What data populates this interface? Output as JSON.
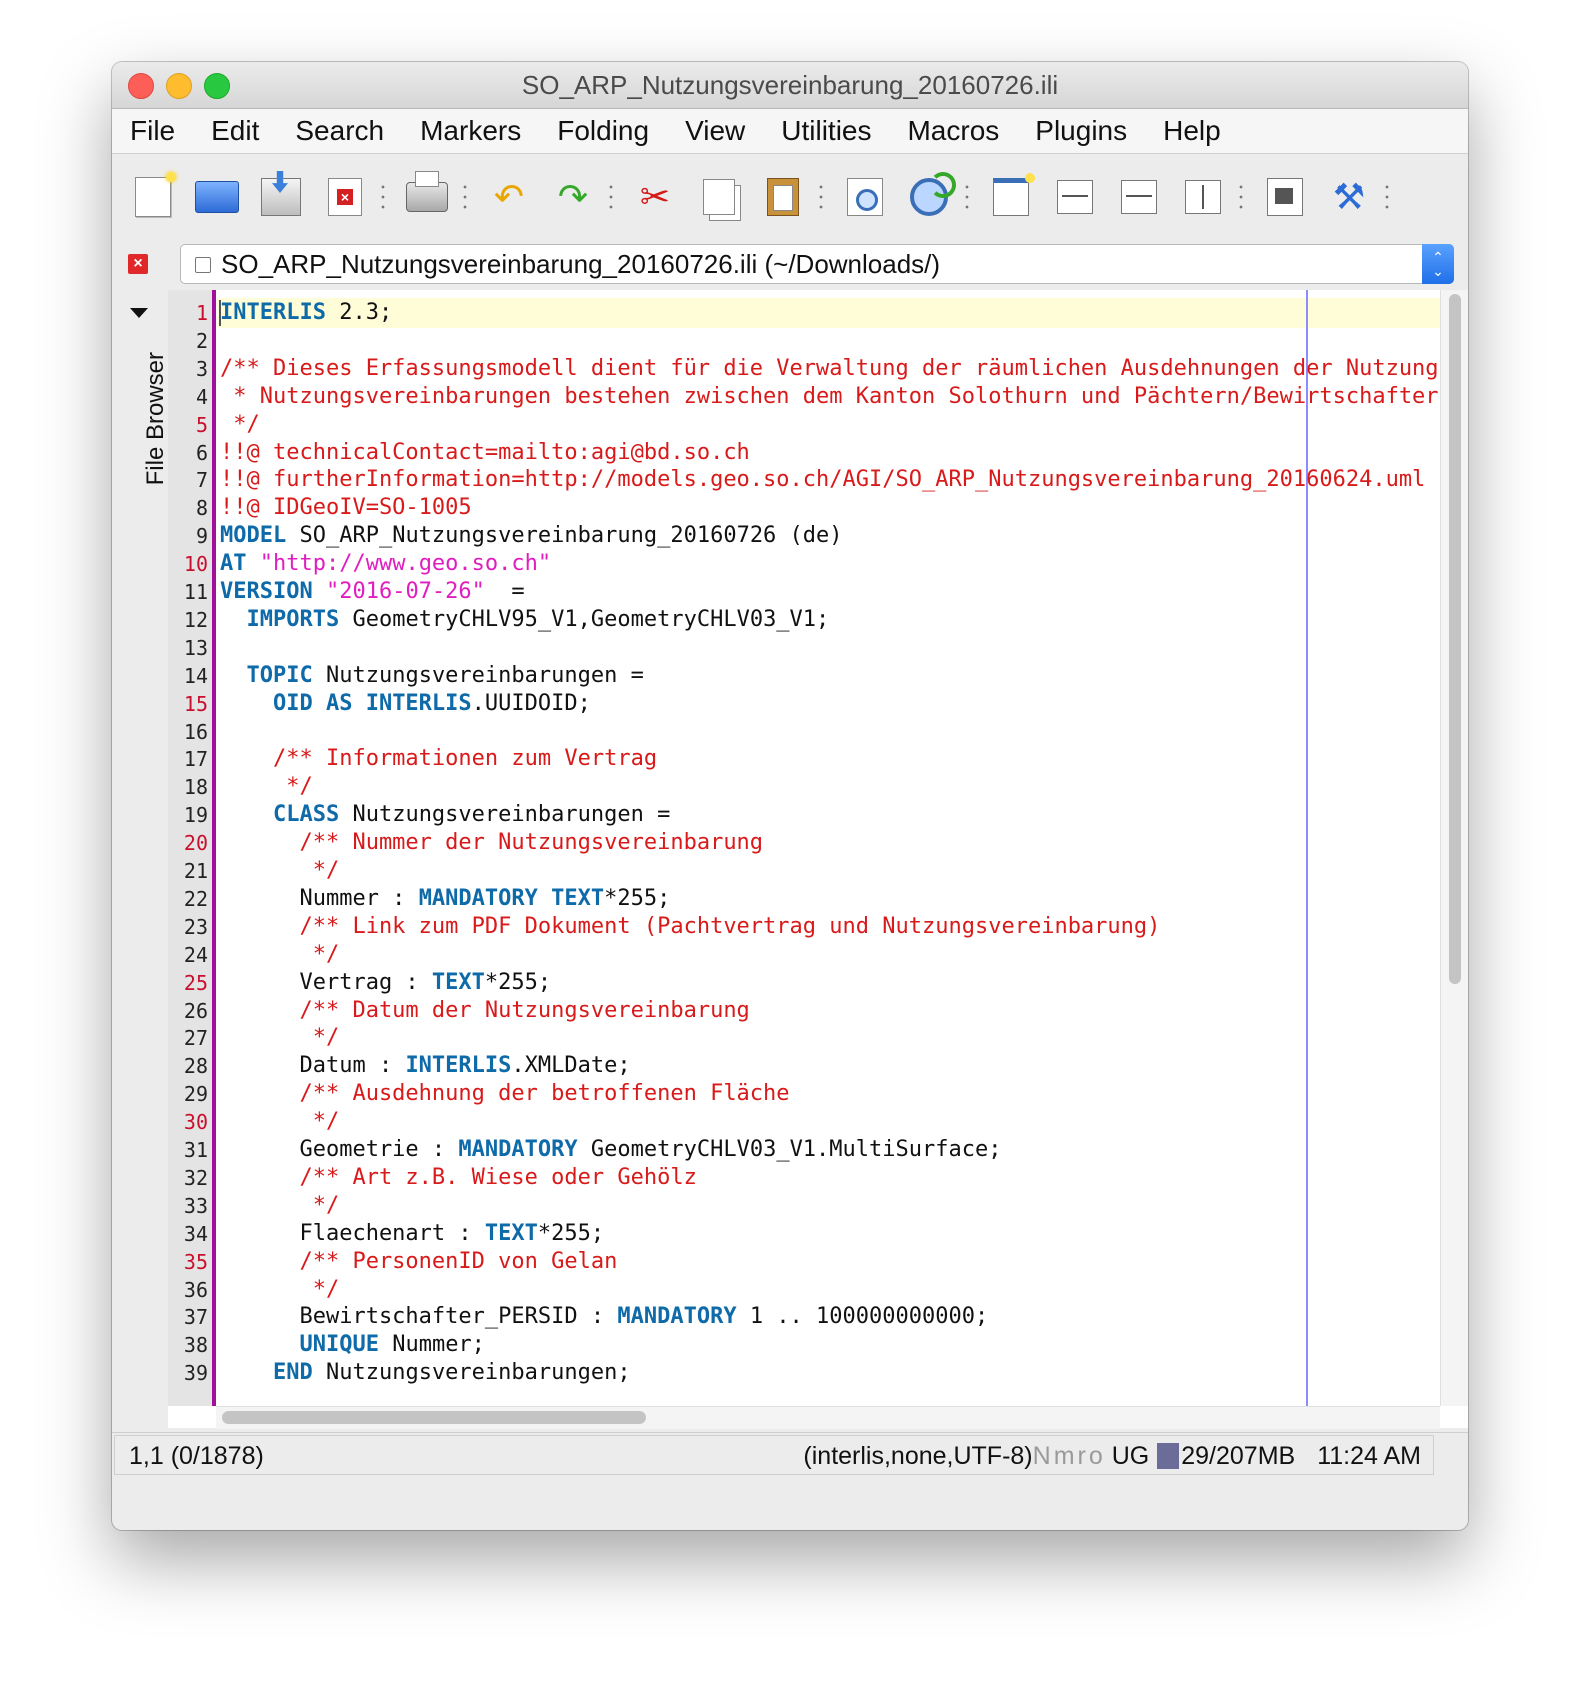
{
  "window": {
    "title": "SO_ARP_Nutzungsvereinbarung_20160726.ili"
  },
  "menu": [
    "File",
    "Edit",
    "Search",
    "Markers",
    "Folding",
    "View",
    "Utilities",
    "Macros",
    "Plugins",
    "Help"
  ],
  "toolbar": {
    "icons": [
      "new-file-icon",
      "open-file-icon",
      "save-file-icon",
      "close-file-icon",
      "print-icon",
      "undo-icon",
      "redo-icon",
      "cut-icon",
      "copy-icon",
      "paste-icon",
      "find-icon",
      "find-replace-icon",
      "new-view-icon",
      "unsplit-icon",
      "split-horizontal-icon",
      "split-vertical-icon",
      "global-options-icon",
      "plugin-manager-icon"
    ]
  },
  "buffer": {
    "label": "SO_ARP_Nutzungsvereinbarung_20160726.ili (~/Downloads/)"
  },
  "dock": {
    "label": "File Browser"
  },
  "editor": {
    "line_numbers": [
      "1",
      "2",
      "3",
      "4",
      "5",
      "6",
      "7",
      "8",
      "9",
      "10",
      "11",
      "12",
      "13",
      "14",
      "15",
      "16",
      "17",
      "18",
      "19",
      "20",
      "21",
      "22",
      "23",
      "24",
      "25",
      "26",
      "27",
      "28",
      "29",
      "30",
      "31",
      "32",
      "33",
      "34",
      "35",
      "36",
      "37",
      "38",
      "39"
    ],
    "lines": [
      [
        {
          "t": "INTERLIS",
          "c": "kw"
        },
        {
          "t": " 2.3;",
          "c": ""
        }
      ],
      [],
      [
        {
          "t": "/** Dieses Erfassungsmodell dient für die Verwaltung der räumlichen Ausdehnungen der Nutzungsvereinbarungen",
          "c": "cm"
        }
      ],
      [
        {
          "t": " * Nutzungsvereinbarungen bestehen zwischen dem Kanton Solothurn und Pächtern/Bewirtschaftern",
          "c": "cm"
        }
      ],
      [
        {
          "t": " */",
          "c": "cm"
        }
      ],
      [
        {
          "t": "!!@ technicalContact=mailto:agi@bd.so.ch",
          "c": "cm"
        }
      ],
      [
        {
          "t": "!!@ furtherInformation=http://models.geo.so.ch/AGI/SO_ARP_Nutzungsvereinbarung_20160624.uml",
          "c": "cm"
        }
      ],
      [
        {
          "t": "!!@ IDGeoIV=SO-1005",
          "c": "cm"
        }
      ],
      [
        {
          "t": "MODEL",
          "c": "kw"
        },
        {
          "t": " SO_ARP_Nutzungsvereinbarung_20160726 (de)",
          "c": ""
        }
      ],
      [
        {
          "t": "AT",
          "c": "kw"
        },
        {
          "t": " ",
          "c": ""
        },
        {
          "t": "\"http://www.geo.so.ch\"",
          "c": "st"
        }
      ],
      [
        {
          "t": "VERSION",
          "c": "kw"
        },
        {
          "t": " ",
          "c": ""
        },
        {
          "t": "\"2016-07-26\"",
          "c": "st"
        },
        {
          "t": "  =",
          "c": ""
        }
      ],
      [
        {
          "t": "  ",
          "c": ""
        },
        {
          "t": "IMPORTS",
          "c": "kw"
        },
        {
          "t": " GeometryCHLV95_V1,GeometryCHLV03_V1;",
          "c": ""
        }
      ],
      [],
      [
        {
          "t": "  ",
          "c": ""
        },
        {
          "t": "TOPIC",
          "c": "kw"
        },
        {
          "t": " Nutzungsvereinbarungen =",
          "c": ""
        }
      ],
      [
        {
          "t": "    ",
          "c": ""
        },
        {
          "t": "OID AS INTERLIS",
          "c": "kw"
        },
        {
          "t": ".UUIDOID;",
          "c": ""
        }
      ],
      [],
      [
        {
          "t": "    /** Informationen zum Vertrag",
          "c": "cm"
        }
      ],
      [
        {
          "t": "     */",
          "c": "cm"
        }
      ],
      [
        {
          "t": "    ",
          "c": ""
        },
        {
          "t": "CLASS",
          "c": "kw"
        },
        {
          "t": " Nutzungsvereinbarungen =",
          "c": ""
        }
      ],
      [
        {
          "t": "      /** Nummer der Nutzungsvereinbarung",
          "c": "cm"
        }
      ],
      [
        {
          "t": "       */",
          "c": "cm"
        }
      ],
      [
        {
          "t": "      Nummer : ",
          "c": ""
        },
        {
          "t": "MANDATORY TEXT",
          "c": "kw"
        },
        {
          "t": "*255;",
          "c": ""
        }
      ],
      [
        {
          "t": "      /** Link zum PDF Dokument (Pachtvertrag und Nutzungsvereinbarung)",
          "c": "cm"
        }
      ],
      [
        {
          "t": "       */",
          "c": "cm"
        }
      ],
      [
        {
          "t": "      Vertrag : ",
          "c": ""
        },
        {
          "t": "TEXT",
          "c": "kw"
        },
        {
          "t": "*255;",
          "c": ""
        }
      ],
      [
        {
          "t": "      /** Datum der Nutzungsvereinbarung",
          "c": "cm"
        }
      ],
      [
        {
          "t": "       */",
          "c": "cm"
        }
      ],
      [
        {
          "t": "      Datum : ",
          "c": ""
        },
        {
          "t": "INTERLIS",
          "c": "kw"
        },
        {
          "t": ".XMLDate;",
          "c": ""
        }
      ],
      [
        {
          "t": "      /** Ausdehnung der betroffenen Fläche",
          "c": "cm"
        }
      ],
      [
        {
          "t": "       */",
          "c": "cm"
        }
      ],
      [
        {
          "t": "      Geometrie : ",
          "c": ""
        },
        {
          "t": "MANDATORY",
          "c": "kw"
        },
        {
          "t": " GeometryCHLV03_V1.MultiSurface;",
          "c": ""
        }
      ],
      [
        {
          "t": "      /** Art z.B. Wiese oder Gehölz",
          "c": "cm"
        }
      ],
      [
        {
          "t": "       */",
          "c": "cm"
        }
      ],
      [
        {
          "t": "      Flaechenart : ",
          "c": ""
        },
        {
          "t": "TEXT",
          "c": "kw"
        },
        {
          "t": "*255;",
          "c": ""
        }
      ],
      [
        {
          "t": "      /** PersonenID von Gelan",
          "c": "cm"
        }
      ],
      [
        {
          "t": "       */",
          "c": "cm"
        }
      ],
      [
        {
          "t": "      Bewirtschafter_PERSID : ",
          "c": ""
        },
        {
          "t": "MANDATORY",
          "c": "kw"
        },
        {
          "t": " 1 .. 100000000000;",
          "c": ""
        }
      ],
      [
        {
          "t": "      ",
          "c": ""
        },
        {
          "t": "UNIQUE",
          "c": "kw"
        },
        {
          "t": " Nummer;",
          "c": ""
        }
      ],
      [
        {
          "t": "    ",
          "c": ""
        },
        {
          "t": "END",
          "c": "kw"
        },
        {
          "t": " Nutzungsvereinbarungen;",
          "c": ""
        }
      ]
    ],
    "marked_lines": [
      1,
      10,
      15,
      20,
      25,
      30,
      35
    ],
    "red_lines": [
      5
    ]
  },
  "status": {
    "position": "1,1 (0/1878)",
    "mode": "(interlis,none,UTF-8)",
    "flags": "Nmro",
    "ug": "UG",
    "memory": "29/207MB",
    "clock": "11:24 AM"
  },
  "colors": {
    "keyword": "#0e6aa8",
    "comment": "#d81a1a",
    "string": "#e01ec0",
    "gutter_border": "#a0129a",
    "wrap_guide": "#8c8cff",
    "current_line": "#fffdd8"
  }
}
